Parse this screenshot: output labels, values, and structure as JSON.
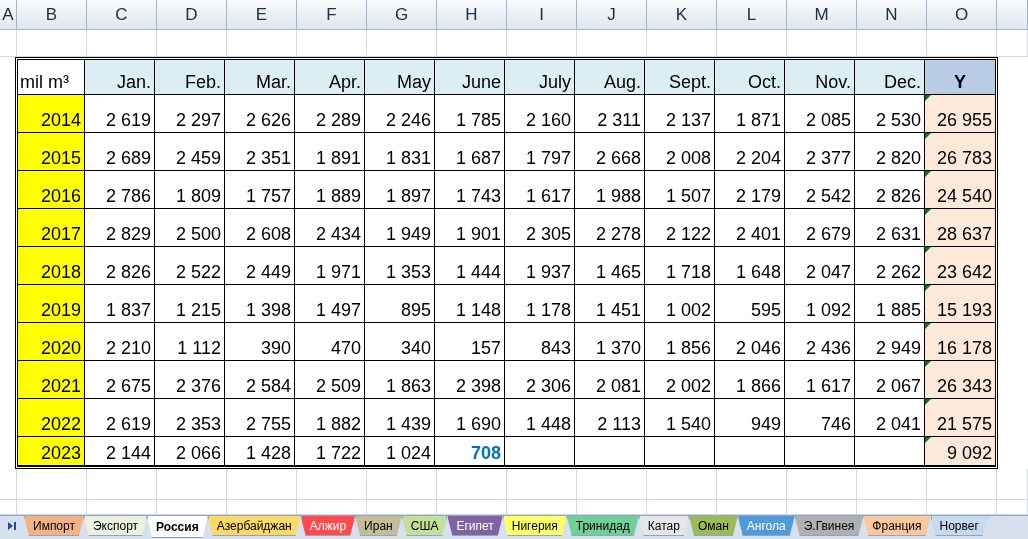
{
  "column_headers": [
    "A",
    "B",
    "C",
    "D",
    "E",
    "F",
    "G",
    "H",
    "I",
    "J",
    "K",
    "L",
    "M",
    "N",
    "O"
  ],
  "table": {
    "corner": "mil m³",
    "columns": [
      "Jan.",
      "Feb.",
      "Mar.",
      "Apr.",
      "May",
      "June",
      "July",
      "Aug.",
      "Sept.",
      "Oct.",
      "Nov.",
      "Dec."
    ],
    "total_column": "Y",
    "rows": [
      {
        "year": "2014",
        "values": [
          "2 619",
          "2 297",
          "2 626",
          "2 289",
          "2 246",
          "1 785",
          "2 160",
          "2 311",
          "2 137",
          "1 871",
          "2 085",
          "2 530"
        ],
        "total": "26 955",
        "last_value_highlighted": false,
        "total_flagged": true
      },
      {
        "year": "2015",
        "values": [
          "2 689",
          "2 459",
          "2 351",
          "1 891",
          "1 831",
          "1 687",
          "1 797",
          "2 668",
          "2 008",
          "2 204",
          "2 377",
          "2 820"
        ],
        "total": "26 783",
        "last_value_highlighted": false,
        "total_flagged": true
      },
      {
        "year": "2016",
        "values": [
          "2 786",
          "1 809",
          "1 757",
          "1 889",
          "1 897",
          "1 743",
          "1 617",
          "1 988",
          "1 507",
          "2 179",
          "2 542",
          "2 826"
        ],
        "total": "24 540",
        "last_value_highlighted": false,
        "total_flagged": true
      },
      {
        "year": "2017",
        "values": [
          "2 829",
          "2 500",
          "2 608",
          "2 434",
          "1 949",
          "1 901",
          "2 305",
          "2 278",
          "2 122",
          "2 401",
          "2 679",
          "2 631"
        ],
        "total": "28 637",
        "last_value_highlighted": false,
        "total_flagged": true
      },
      {
        "year": "2018",
        "values": [
          "2 826",
          "2 522",
          "2 449",
          "1 971",
          "1 353",
          "1 444",
          "1 937",
          "1 465",
          "1 718",
          "1 648",
          "2 047",
          "2 262"
        ],
        "total": "23 642",
        "last_value_highlighted": false,
        "total_flagged": true
      },
      {
        "year": "2019",
        "values": [
          "1 837",
          "1 215",
          "1 398",
          "1 497",
          "895",
          "1 148",
          "1 178",
          "1 451",
          "1 002",
          "595",
          "1 092",
          "1 885"
        ],
        "total": "15 193",
        "last_value_highlighted": false,
        "total_flagged": true
      },
      {
        "year": "2020",
        "values": [
          "2 210",
          "1 112",
          "390",
          "470",
          "340",
          "157",
          "843",
          "1 370",
          "1 856",
          "2 046",
          "2 436",
          "2 949"
        ],
        "total": "16 178",
        "last_value_highlighted": false,
        "total_flagged": true
      },
      {
        "year": "2021",
        "values": [
          "2 675",
          "2 376",
          "2 584",
          "2 509",
          "1 863",
          "2 398",
          "2 306",
          "2 081",
          "2 002",
          "1 866",
          "1 617",
          "2 067"
        ],
        "total": "26 343",
        "last_value_highlighted": false,
        "total_flagged": true
      },
      {
        "year": "2022",
        "values": [
          "2 619",
          "2 353",
          "2 755",
          "1 882",
          "1 439",
          "1 690",
          "1 448",
          "2 113",
          "1 540",
          "949",
          "746",
          "2 041"
        ],
        "total": "21 575",
        "last_value_highlighted": false,
        "total_flagged": true
      },
      {
        "year": "2023",
        "values": [
          "2 144",
          "2 066",
          "1 428",
          "1 722",
          "1 024",
          "708"
        ],
        "total": "9 092",
        "last_value_highlighted": true,
        "total_flagged": true
      }
    ]
  },
  "sheet_tabs": [
    {
      "label": "Импорт",
      "color": "#f4b183",
      "light_label": false,
      "selected": false
    },
    {
      "label": "Экспорт",
      "color": "#ebf1de",
      "light_label": false,
      "selected": false
    },
    {
      "label": "Россия",
      "color": "#ffffff",
      "light_label": false,
      "selected": true
    },
    {
      "label": "Азербайджан",
      "color": "#ffd966",
      "light_label": false,
      "selected": false
    },
    {
      "label": "Алжир",
      "color": "#ff4b4b",
      "light_label": true,
      "selected": false
    },
    {
      "label": "Иран",
      "color": "#c4bd97",
      "light_label": false,
      "selected": false
    },
    {
      "label": "США",
      "color": "#c3e09a",
      "light_label": false,
      "selected": false
    },
    {
      "label": "Египет",
      "color": "#8064a2",
      "light_label": true,
      "selected": false
    },
    {
      "label": "Нигерия",
      "color": "#ffff66",
      "light_label": false,
      "selected": false
    },
    {
      "label": "Тринидад",
      "color": "#6fcf97",
      "light_label": false,
      "selected": false
    },
    {
      "label": "Катар",
      "color": "#e6e6e6",
      "light_label": false,
      "selected": false
    },
    {
      "label": "Оман",
      "color": "#9bbb59",
      "light_label": false,
      "selected": false
    },
    {
      "label": "Ангола",
      "color": "#4f9bd9",
      "light_label": true,
      "selected": false
    },
    {
      "label": "Э.Гвинея",
      "color": "#b0b0b0",
      "light_label": false,
      "selected": false
    },
    {
      "label": "Франция",
      "color": "#fbc89b",
      "light_label": false,
      "selected": false
    },
    {
      "label": "Норвег",
      "color": "#c5d9f1",
      "light_label": false,
      "selected": false
    }
  ]
}
